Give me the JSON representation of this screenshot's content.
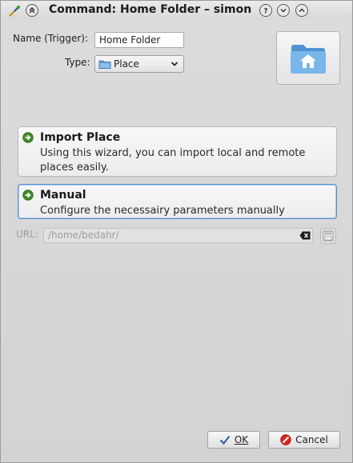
{
  "window": {
    "title": "Command: Home Folder – simon",
    "title_buttons": [
      "app-icon",
      "keep-above-icon",
      "help-icon",
      "minimize-icon",
      "maximize-icon"
    ]
  },
  "form": {
    "name_label": "Name (Trigger):",
    "name_value": "Home Folder",
    "type_label": "Type:",
    "type_value": "Place",
    "type_icon": "folder-icon",
    "command_icon": "home-folder-icon"
  },
  "options": [
    {
      "title": "Import Place",
      "description": "Using this wizard, you can import local and remote places easily.",
      "icon": "green-arrow-icon",
      "selected": false
    },
    {
      "title": "Manual",
      "description": "Configure the necessairy parameters manually",
      "icon": "green-arrow-icon",
      "selected": true
    }
  ],
  "url": {
    "label": "URL:",
    "value": "/home/bedahr/",
    "enabled": false
  },
  "buttons": {
    "ok_label": "OK",
    "cancel_label": "Cancel"
  },
  "colors": {
    "accent_border": "#5c8fcc",
    "arrow_green": "#3f8a2a",
    "folder_blue": "#5aa0dc"
  }
}
